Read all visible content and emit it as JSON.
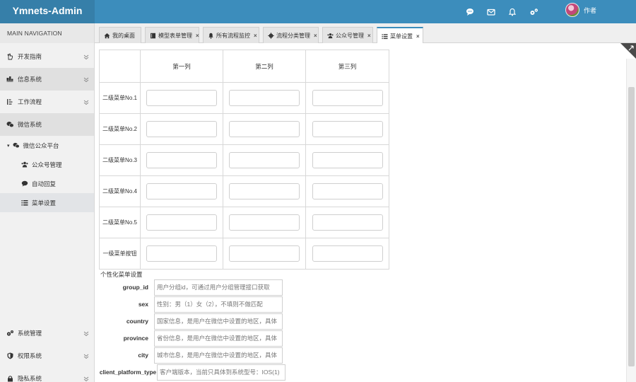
{
  "app": {
    "title": "Ymnets-Admin"
  },
  "header": {
    "icons": [
      "chat-icon",
      "mail-icon",
      "bell-icon",
      "settings-icon"
    ],
    "user_name": "作者"
  },
  "sidebar": {
    "heading": "MAIN NAVIGATION",
    "items": [
      {
        "label": "开发指南",
        "icon": "hand-icon"
      },
      {
        "label": "信息系统",
        "icon": "sitemap-icon"
      },
      {
        "label": "工作流程",
        "icon": "list-icon"
      },
      {
        "label": "微信系统",
        "icon": "wechat-icon"
      }
    ],
    "submenu": {
      "label": "微信公众平台",
      "items": [
        {
          "label": "公众号管理",
          "icon": "users-icon"
        },
        {
          "label": "自动回复",
          "icon": "comment-icon"
        },
        {
          "label": "菜单设置",
          "icon": "menu-icon",
          "active": true
        }
      ]
    },
    "bottom_items": [
      {
        "label": "系统管理",
        "icon": "gears-icon"
      },
      {
        "label": "权限系统",
        "icon": "shield-icon"
      },
      {
        "label": "隐私系统",
        "icon": "lock-icon"
      }
    ]
  },
  "tabs": [
    {
      "label": "我的桌面",
      "icon": "home-icon",
      "closable": false
    },
    {
      "label": "模型表单管理",
      "icon": "book-icon",
      "closable": true
    },
    {
      "label": "所有流程监控",
      "icon": "bell-icon",
      "closable": true
    },
    {
      "label": "流程分类管理",
      "icon": "gear-icon",
      "closable": true
    },
    {
      "label": "公众号管理",
      "icon": "users-icon",
      "closable": true
    },
    {
      "label": "菜单设置",
      "icon": "menu-icon",
      "closable": true,
      "active": true
    }
  ],
  "menu_table": {
    "columns": [
      "第一列",
      "第二列",
      "第三列"
    ],
    "rows": [
      "二级菜单No.1",
      "二级菜单No.2",
      "二级菜单No.3",
      "二级菜单No.4",
      "二级菜单No.5",
      "一级菜单按钮"
    ]
  },
  "personalized": {
    "title": "个性化菜单设置",
    "fields": [
      {
        "label": "group_id",
        "placeholder": "用户分组id，可通过用户分组管理接口获取"
      },
      {
        "label": "sex",
        "placeholder": "性别：男（1）女（2），不填则不做匹配"
      },
      {
        "label": "country",
        "placeholder": "国家信息，是用户在微信中设置的地区，具体"
      },
      {
        "label": "province",
        "placeholder": "省份信息，是用户在微信中设置的地区，具体"
      },
      {
        "label": "city",
        "placeholder": "城市信息，是用户在微信中设置的地区，具体"
      },
      {
        "label": "client_platform_type",
        "placeholder": "客户端版本，当前只具体到系统型号：IOS(1)"
      }
    ]
  },
  "colors": {
    "primary": "#3c8dbc",
    "logo_bg": "#367fa9",
    "sidebar_bg": "#f1f1f1"
  }
}
